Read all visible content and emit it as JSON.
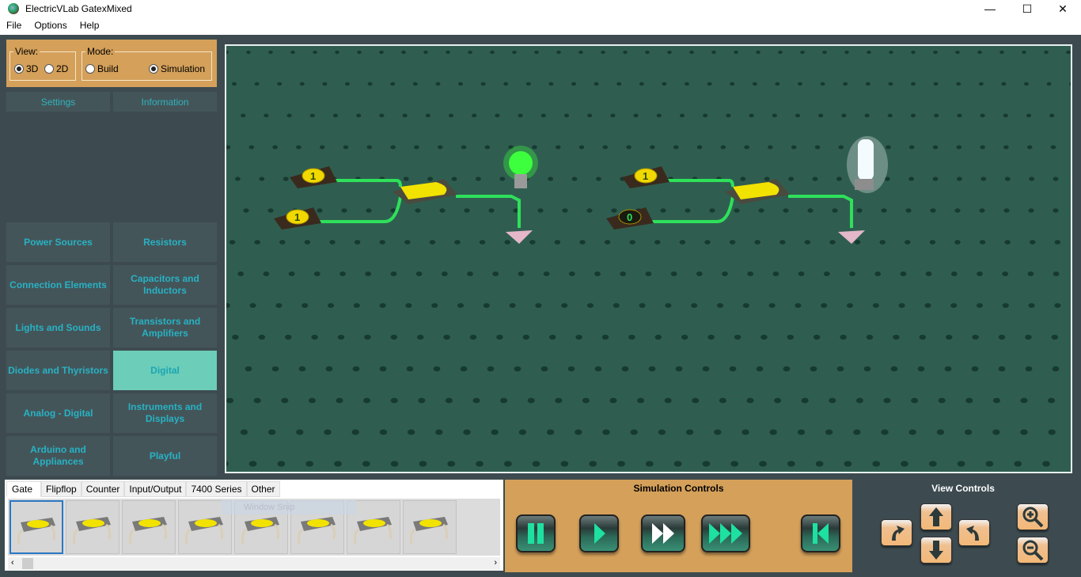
{
  "window": {
    "title": "ElectricVLab  GatexMixed",
    "minimize": "—",
    "maximize": "☐",
    "close": "✕"
  },
  "menu": [
    "File",
    "Options",
    "Help"
  ],
  "view": {
    "legend": "View:",
    "options": [
      {
        "label": "3D",
        "selected": true
      },
      {
        "label": "2D",
        "selected": false
      }
    ]
  },
  "mode": {
    "legend": "Mode:",
    "options": [
      {
        "label": "Build",
        "selected": false
      },
      {
        "label": "Simulation",
        "selected": true
      }
    ]
  },
  "side_tabs": [
    "Settings",
    "Information"
  ],
  "categories": [
    "Power Sources",
    "Resistors",
    "Connection Elements",
    "Capacitors and Inductors",
    "Lights and Sounds",
    "Transistors and Amplifiers",
    "Diodes and Thyristors",
    "Digital",
    "Analog - Digital",
    "Instruments and Displays",
    "Arduino and Appliances",
    "Playful"
  ],
  "active_category": "Digital",
  "circuit": {
    "left": {
      "inputs": [
        "1",
        "1"
      ],
      "lamp": "on"
    },
    "right": {
      "inputs": [
        "1",
        "0"
      ],
      "lamp": "on"
    }
  },
  "palette": {
    "tabs": [
      "Gate",
      "Flipflop",
      "Counter",
      "Input/Output",
      "7400 Series",
      "Other"
    ],
    "selected_tab": "Gate",
    "item_count": 8,
    "overlay": "Window Snip"
  },
  "sim_controls": {
    "title": "Simulation Controls",
    "buttons": [
      "pause",
      "play",
      "fast-forward",
      "fastest",
      "reset"
    ]
  },
  "view_controls": {
    "title": "View Controls",
    "buttons": [
      "rotate-left",
      "up",
      "down",
      "rotate-right",
      "zoom-in",
      "zoom-out"
    ]
  },
  "colors": {
    "accent": "#d4a05a",
    "canvas": "#2f5e50",
    "category_text": "#27b2c4",
    "active_category": "#6ccdb8"
  }
}
